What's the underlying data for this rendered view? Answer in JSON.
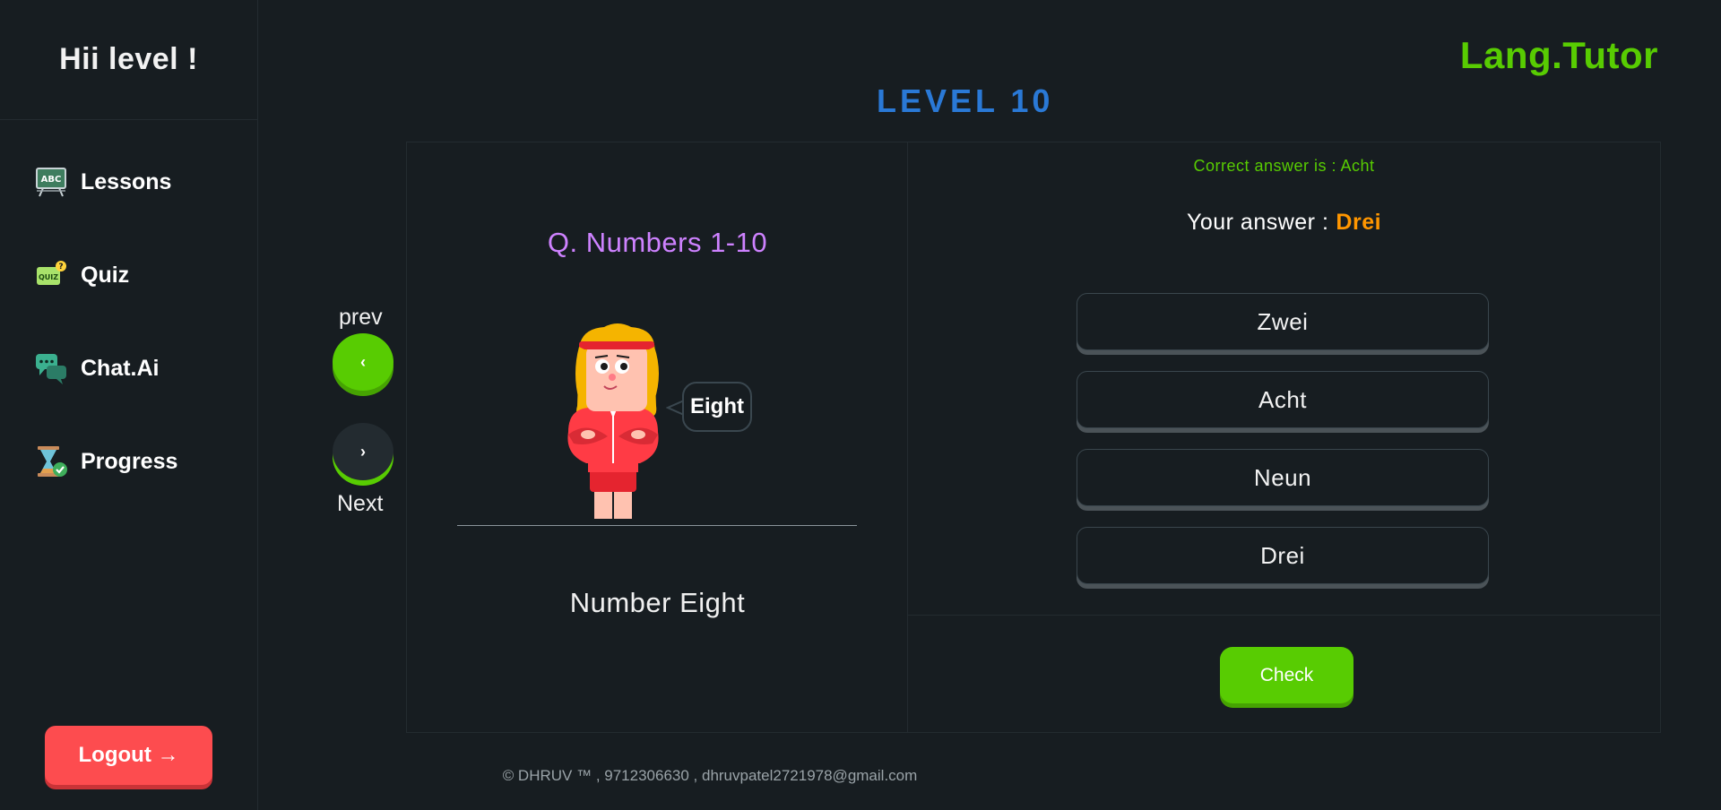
{
  "sidebar": {
    "greeting": "Hii level !",
    "items": [
      {
        "label": "Lessons",
        "icon": "lesson-board-icon"
      },
      {
        "label": "Quiz",
        "icon": "quiz-icon"
      },
      {
        "label": "Chat.Ai",
        "icon": "chat-bubbles-icon"
      },
      {
        "label": "Progress",
        "icon": "hourglass-check-icon"
      }
    ],
    "logout_label": "Logout →"
  },
  "header": {
    "brand": "Lang.Tutor",
    "level_title": "LEVEL  10"
  },
  "navigation": {
    "prev_label": "prev",
    "prev_symbol": "‹",
    "next_label": "Next",
    "next_symbol": "›"
  },
  "question": {
    "title": "Q. Numbers 1-10",
    "bubble_text": "Eight",
    "caption": "Number Eight"
  },
  "answer": {
    "correct_text": "Correct answer is : Acht",
    "your_answer_label": "Your answer :",
    "your_answer_value": "Drei",
    "options": [
      "Zwei",
      "Acht",
      "Neun",
      "Drei"
    ],
    "check_label": "Check"
  },
  "footer": {
    "text": "© DHRUV ™ , 9712306630 , dhruvpatel2721978@gmail.com"
  },
  "colors": {
    "background": "#171d21",
    "brand_green": "#58cc02",
    "level_blue": "#2a79d6",
    "question_purple": "#ce82ff",
    "answer_orange": "#ff9600",
    "logout_red": "#fd4c4f"
  }
}
